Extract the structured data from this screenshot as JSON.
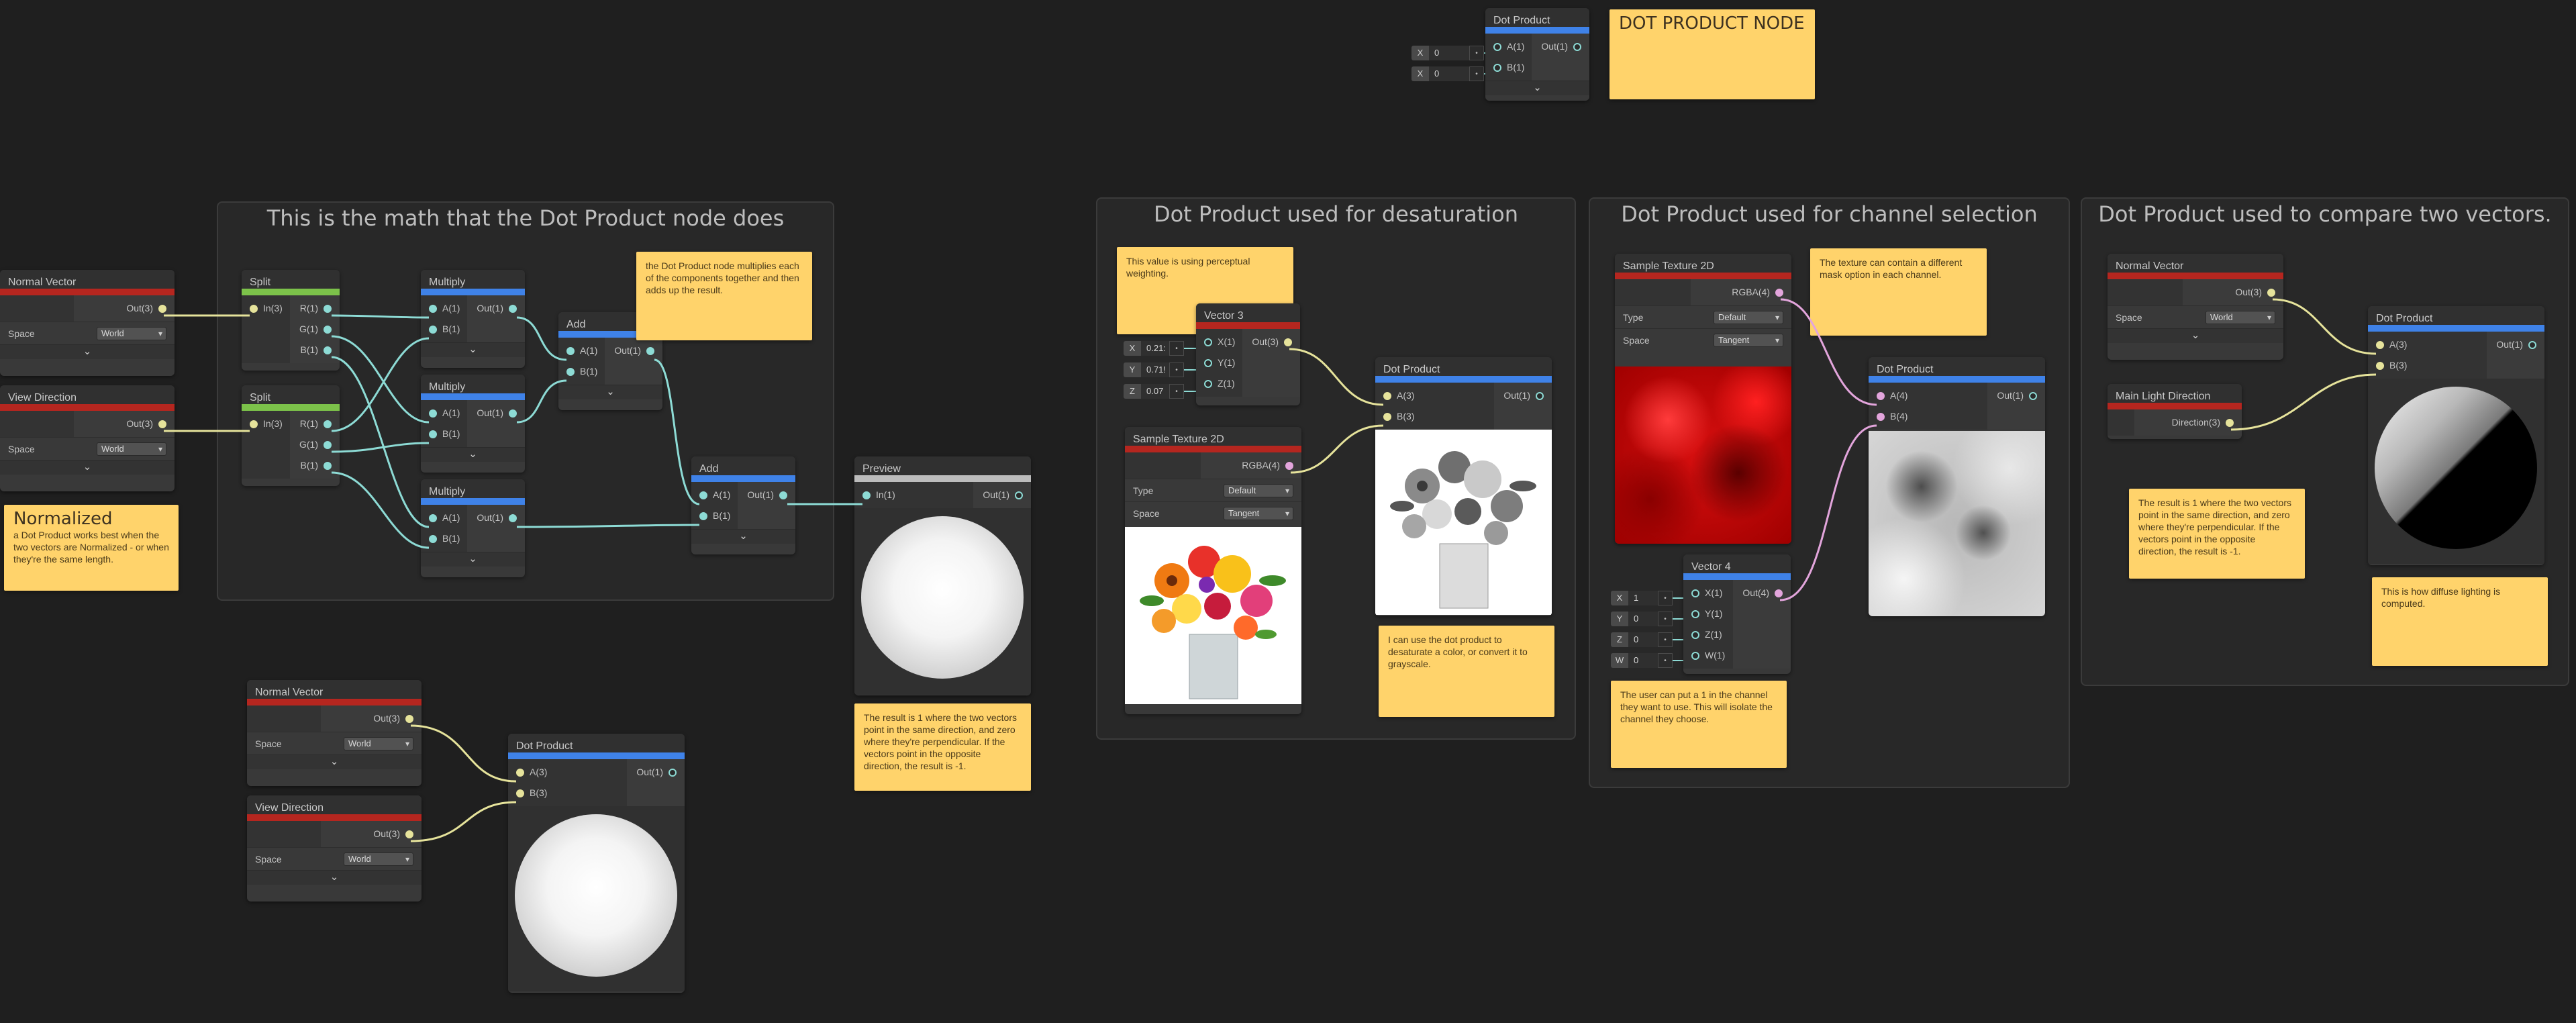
{
  "groups": {
    "math": {
      "title": "This is the math that the Dot Product node does"
    },
    "desat": {
      "title": "Dot Product used for desaturation"
    },
    "channel": {
      "title": "Dot Product used for channel selection"
    },
    "compare": {
      "title": "Dot Product used to compare two vectors."
    }
  },
  "sticky": {
    "header": {
      "title": "DOT PRODUCT NODE"
    },
    "normalized": {
      "title": "Normalized",
      "body": "a Dot Product works best when the two vectors are Normalized - or when they're the same length."
    },
    "math_explain": {
      "body": "the Dot Product node multiplies each of the components together and then adds up the result."
    },
    "result_math": {
      "body": "The result is 1 where the two vectors point in the same direction, and zero where they're perpendicular. If the vectors point in the opposite direction, the result is -1."
    },
    "perceptual": {
      "body": "This value is using perceptual weighting."
    },
    "grayscale": {
      "body": "I can use the dot product to desaturate a color, or convert it to grayscale."
    },
    "mask": {
      "body": "The texture can contain a different mask option in each channel."
    },
    "user_channel": {
      "body": "The user can put a 1 in the channel they want to use.  This will isolate the channel they choose."
    },
    "result_compare": {
      "body": "The result is 1 where the two vectors point in the same direction, and zero where they're perpendicular. If the vectors point in the opposite direction, the result is -1."
    },
    "diffuse": {
      "body": "This is how diffuse lighting is computed."
    }
  },
  "labels": {
    "normal_vector": "Normal Vector",
    "view_direction": "View Direction",
    "main_light_direction": "Main Light Direction",
    "split": "Split",
    "multiply": "Multiply",
    "add": "Add",
    "preview": "Preview",
    "dot_product": "Dot Product",
    "vector3": "Vector 3",
    "vector4": "Vector 4",
    "sample_texture_2d": "Sample Texture 2D",
    "space": "Space",
    "type": "Type",
    "world": "World",
    "tangent": "Tangent",
    "default": "Default",
    "out3": "Out(3)",
    "out1": "Out(1)",
    "out4": "Out(4)",
    "in3": "In(3)",
    "in1": "In(1)",
    "a1": "A(1)",
    "b1": "B(1)",
    "a3": "A(3)",
    "b3": "B(3)",
    "a4": "A(4)",
    "b4": "B(4)",
    "r1": "R(1)",
    "g1": "G(1)",
    "b1c": "B(1)",
    "x1": "X(1)",
    "y1": "Y(1)",
    "z1": "Z(1)",
    "w1": "W(1)",
    "rgba4": "RGBA(4)",
    "direction3": "Direction(3)",
    "chevron": "⌄"
  },
  "fields": {
    "top_dot": [
      {
        "label": "X",
        "value": "0"
      },
      {
        "label": "X",
        "value": "0"
      }
    ],
    "vector3": [
      {
        "label": "X",
        "value": "0.21:"
      },
      {
        "label": "Y",
        "value": "0.71!"
      },
      {
        "label": "Z",
        "value": "0.07"
      }
    ],
    "vector4": [
      {
        "label": "X",
        "value": "1"
      },
      {
        "label": "Y",
        "value": "0"
      },
      {
        "label": "Z",
        "value": "0"
      },
      {
        "label": "W",
        "value": "0"
      }
    ],
    "knob": "•"
  },
  "colors": {
    "background": "#1f1f1f",
    "header_red": "#b5261f",
    "header_blue": "#3f82e8",
    "header_green": "#7cc24a",
    "wire_yellow": "#e6e39b",
    "wire_cyan": "#8ddbd5",
    "wire_pink": "#e3a5dc",
    "sticky": "#ffd36b"
  }
}
